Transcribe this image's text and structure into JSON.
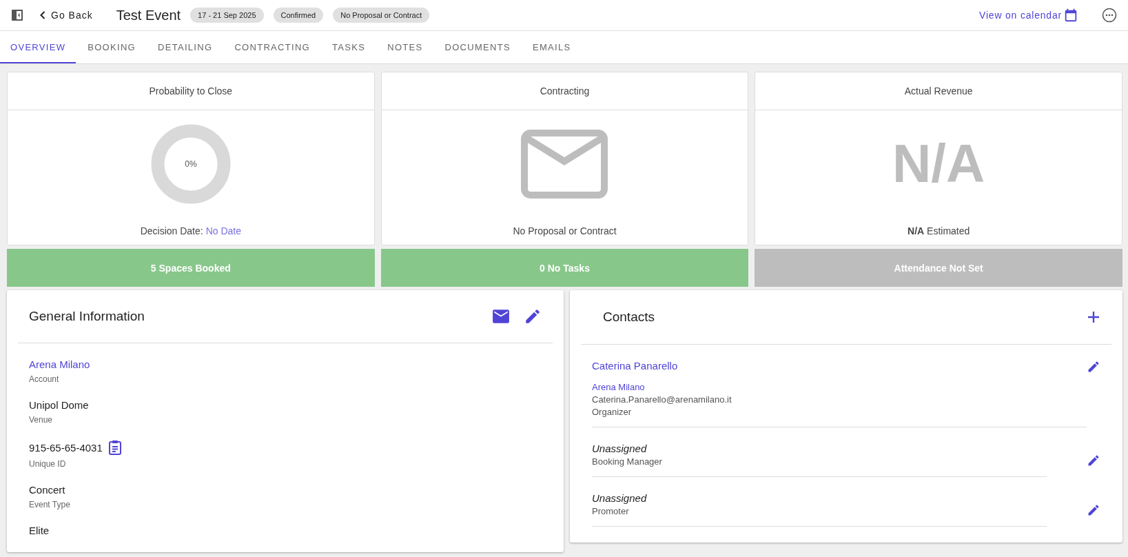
{
  "header": {
    "back": "Go Back",
    "title": "Test Event",
    "chips": [
      "17 - 21 Sep 2025",
      "Confirmed",
      "No Proposal or Contract"
    ],
    "calendar_link": "View on calendar"
  },
  "tabs": [
    {
      "label": "OVERVIEW",
      "selected": true
    },
    {
      "label": "BOOKING",
      "selected": false
    },
    {
      "label": "DETAILING",
      "selected": false
    },
    {
      "label": "CONTRACTING",
      "selected": false
    },
    {
      "label": "TASKS",
      "selected": false
    },
    {
      "label": "NOTES",
      "selected": false
    },
    {
      "label": "DOCUMENTS",
      "selected": false
    },
    {
      "label": "EMAILS",
      "selected": false
    }
  ],
  "cards": [
    {
      "kind": "gauge",
      "title": "Probability to Close",
      "level": 0,
      "reading": "0%",
      "footer_label": "Decision Date: ",
      "footer_link": "No Date"
    },
    {
      "kind": "mail",
      "title": "Contracting",
      "footer": "No Proposal or Contract"
    },
    {
      "kind": "big_text",
      "title": "Actual Revenue",
      "big": "N/A",
      "footer": "**N/A** Estimated"
    }
  ],
  "status_bars": [
    {
      "label": "5 Spaces Booked",
      "color": "#88c78a"
    },
    {
      "label": "0 No Tasks",
      "color": "#88c78a"
    },
    {
      "label": "Attendance Not Set",
      "color": "#bdbdbd"
    }
  ],
  "general_information": {
    "title": "General Information",
    "fields": [
      {
        "value": "Arena Milano",
        "label": "Account",
        "kind": "link"
      },
      {
        "value": "Unipol Dome",
        "label": "Venue",
        "kind": "text"
      },
      {
        "value": "915-65-65-4031",
        "label": "Unique ID",
        "kind": "copy"
      },
      {
        "value": "Concert",
        "label": "Event Type",
        "kind": "text"
      },
      {
        "value": "Elite",
        "kind": "text"
      }
    ]
  },
  "contacts": {
    "title": "Contacts",
    "items": [
      {
        "kind": "contact",
        "name": "Caterina Panarello",
        "account": "Arena Milano",
        "email": "Caterina.Panarello@arenamilano.it",
        "role": "Organizer"
      },
      {
        "kind": "unassigned",
        "name": "Unassigned",
        "role": "Booking Manager"
      },
      {
        "kind": "unassigned",
        "name": "Unassigned",
        "role": "Promoter"
      }
    ]
  }
}
